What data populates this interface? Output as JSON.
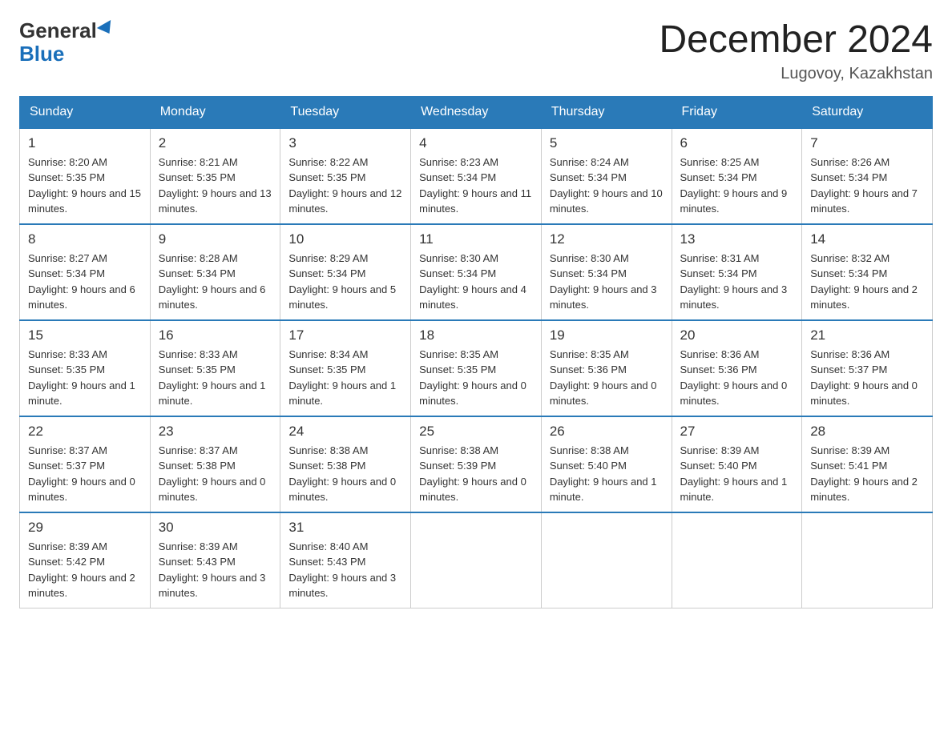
{
  "logo": {
    "general": "General",
    "blue": "Blue"
  },
  "title": "December 2024",
  "location": "Lugovoy, Kazakhstan",
  "days_of_week": [
    "Sunday",
    "Monday",
    "Tuesday",
    "Wednesday",
    "Thursday",
    "Friday",
    "Saturday"
  ],
  "weeks": [
    [
      {
        "day": "1",
        "sunrise": "8:20 AM",
        "sunset": "5:35 PM",
        "daylight": "9 hours and 15 minutes."
      },
      {
        "day": "2",
        "sunrise": "8:21 AM",
        "sunset": "5:35 PM",
        "daylight": "9 hours and 13 minutes."
      },
      {
        "day": "3",
        "sunrise": "8:22 AM",
        "sunset": "5:35 PM",
        "daylight": "9 hours and 12 minutes."
      },
      {
        "day": "4",
        "sunrise": "8:23 AM",
        "sunset": "5:34 PM",
        "daylight": "9 hours and 11 minutes."
      },
      {
        "day": "5",
        "sunrise": "8:24 AM",
        "sunset": "5:34 PM",
        "daylight": "9 hours and 10 minutes."
      },
      {
        "day": "6",
        "sunrise": "8:25 AM",
        "sunset": "5:34 PM",
        "daylight": "9 hours and 9 minutes."
      },
      {
        "day": "7",
        "sunrise": "8:26 AM",
        "sunset": "5:34 PM",
        "daylight": "9 hours and 7 minutes."
      }
    ],
    [
      {
        "day": "8",
        "sunrise": "8:27 AM",
        "sunset": "5:34 PM",
        "daylight": "9 hours and 6 minutes."
      },
      {
        "day": "9",
        "sunrise": "8:28 AM",
        "sunset": "5:34 PM",
        "daylight": "9 hours and 6 minutes."
      },
      {
        "day": "10",
        "sunrise": "8:29 AM",
        "sunset": "5:34 PM",
        "daylight": "9 hours and 5 minutes."
      },
      {
        "day": "11",
        "sunrise": "8:30 AM",
        "sunset": "5:34 PM",
        "daylight": "9 hours and 4 minutes."
      },
      {
        "day": "12",
        "sunrise": "8:30 AM",
        "sunset": "5:34 PM",
        "daylight": "9 hours and 3 minutes."
      },
      {
        "day": "13",
        "sunrise": "8:31 AM",
        "sunset": "5:34 PM",
        "daylight": "9 hours and 3 minutes."
      },
      {
        "day": "14",
        "sunrise": "8:32 AM",
        "sunset": "5:34 PM",
        "daylight": "9 hours and 2 minutes."
      }
    ],
    [
      {
        "day": "15",
        "sunrise": "8:33 AM",
        "sunset": "5:35 PM",
        "daylight": "9 hours and 1 minute."
      },
      {
        "day": "16",
        "sunrise": "8:33 AM",
        "sunset": "5:35 PM",
        "daylight": "9 hours and 1 minute."
      },
      {
        "day": "17",
        "sunrise": "8:34 AM",
        "sunset": "5:35 PM",
        "daylight": "9 hours and 1 minute."
      },
      {
        "day": "18",
        "sunrise": "8:35 AM",
        "sunset": "5:35 PM",
        "daylight": "9 hours and 0 minutes."
      },
      {
        "day": "19",
        "sunrise": "8:35 AM",
        "sunset": "5:36 PM",
        "daylight": "9 hours and 0 minutes."
      },
      {
        "day": "20",
        "sunrise": "8:36 AM",
        "sunset": "5:36 PM",
        "daylight": "9 hours and 0 minutes."
      },
      {
        "day": "21",
        "sunrise": "8:36 AM",
        "sunset": "5:37 PM",
        "daylight": "9 hours and 0 minutes."
      }
    ],
    [
      {
        "day": "22",
        "sunrise": "8:37 AM",
        "sunset": "5:37 PM",
        "daylight": "9 hours and 0 minutes."
      },
      {
        "day": "23",
        "sunrise": "8:37 AM",
        "sunset": "5:38 PM",
        "daylight": "9 hours and 0 minutes."
      },
      {
        "day": "24",
        "sunrise": "8:38 AM",
        "sunset": "5:38 PM",
        "daylight": "9 hours and 0 minutes."
      },
      {
        "day": "25",
        "sunrise": "8:38 AM",
        "sunset": "5:39 PM",
        "daylight": "9 hours and 0 minutes."
      },
      {
        "day": "26",
        "sunrise": "8:38 AM",
        "sunset": "5:40 PM",
        "daylight": "9 hours and 1 minute."
      },
      {
        "day": "27",
        "sunrise": "8:39 AM",
        "sunset": "5:40 PM",
        "daylight": "9 hours and 1 minute."
      },
      {
        "day": "28",
        "sunrise": "8:39 AM",
        "sunset": "5:41 PM",
        "daylight": "9 hours and 2 minutes."
      }
    ],
    [
      {
        "day": "29",
        "sunrise": "8:39 AM",
        "sunset": "5:42 PM",
        "daylight": "9 hours and 2 minutes."
      },
      {
        "day": "30",
        "sunrise": "8:39 AM",
        "sunset": "5:43 PM",
        "daylight": "9 hours and 3 minutes."
      },
      {
        "day": "31",
        "sunrise": "8:40 AM",
        "sunset": "5:43 PM",
        "daylight": "9 hours and 3 minutes."
      },
      null,
      null,
      null,
      null
    ]
  ]
}
